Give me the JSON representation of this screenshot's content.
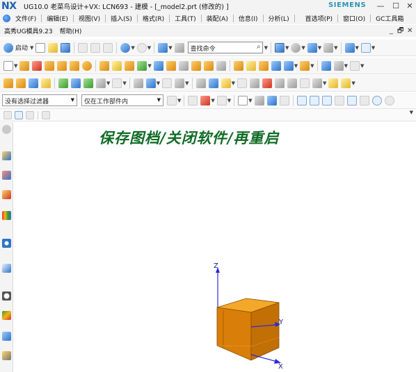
{
  "window": {
    "logo": "NX",
    "title": "UG10.0 老菜鸟设计+VX:  LCN693 - 建模 - [_model2.prt  (修改的)  ]",
    "brand": "SIEMENS",
    "controls": {
      "minimize": "—",
      "maximize": "☐",
      "close": "✕"
    }
  },
  "menu_main": [
    "文件(F)",
    "编辑(E)",
    "视图(V)",
    "插入(S)",
    "格式(R)",
    "工具(T)",
    "装配(A)",
    "信息(I)",
    "分析(L)",
    "首选项(P)",
    "窗口(O)",
    "GC工具箱"
  ],
  "menu_second": [
    "高秀UG模具9.23",
    "帮助(H)"
  ],
  "doc_controls": {
    "minimize": "_",
    "restore": "🗗",
    "close": "✕"
  },
  "toolbar": {
    "start_label": "启动",
    "search_placeholder": "查找命令",
    "selection_filter": "没有选择过滤器",
    "selection_scope": "仅在工作部件内"
  },
  "canvas": {
    "overlay_text": "保存图档/关闭软件/再重启",
    "axes": {
      "x": "X",
      "y": "Y",
      "z": "Z"
    },
    "colors": {
      "overlay_text": "#106b25",
      "cube_front": "#d97e08",
      "cube_top": "#f4a82a",
      "cube_side": "#c26f06",
      "axis": "#2a2ad6"
    }
  }
}
